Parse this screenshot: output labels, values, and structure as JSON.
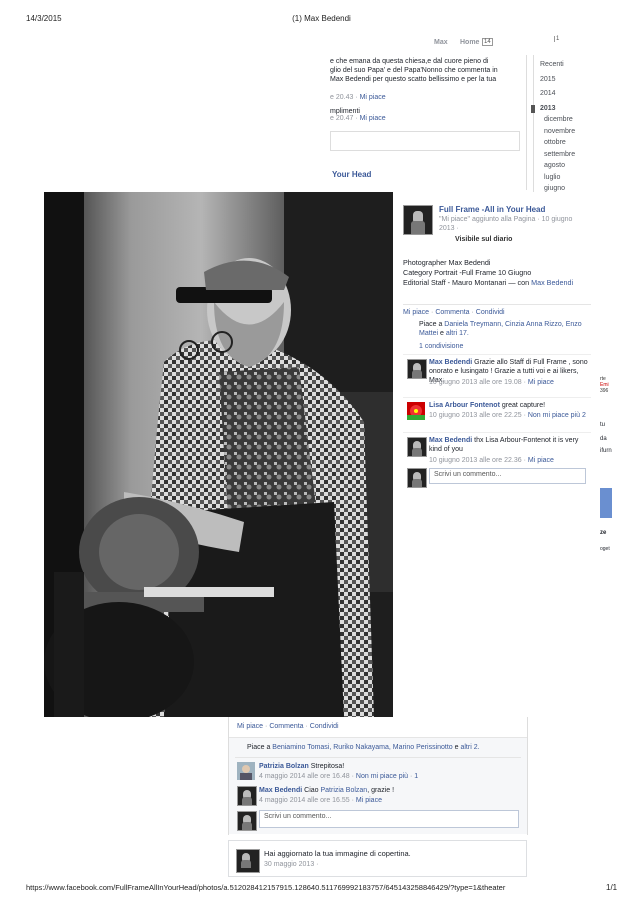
{
  "print_header": {
    "date": "14/3/2015",
    "title": "(1) Max Bedendi"
  },
  "topbar": {
    "user": "Max",
    "home": "Home",
    "home_count": "14",
    "notif": "1"
  },
  "year_sidebar": {
    "items": [
      "Recenti",
      "2015",
      "2014",
      "2013"
    ],
    "months": [
      "dicembre",
      "novembre",
      "ottobre",
      "settembre",
      "agosto",
      "luglio",
      "giugno",
      "maggio"
    ]
  },
  "bg_post": {
    "lines": [
      "e che emana da questa chiesa,e dal cuore pieno di",
      "glio del suo Papa' e del Papa'Nonno che commenta in",
      " Max Bedendi per questo scatto bellissimo e per la tua"
    ],
    "time1": "e 20.43",
    "like1": "Mi piace",
    "line2": "mplimenti",
    "time2": "e 20.47",
    "like2": "Mi piace",
    "your_head": "Your Head"
  },
  "theater": {
    "page_name": "Full Frame -All in Your Head",
    "subtitle": "\"Mi piace\" aggiunto alla Pagina · 10 giugno 2013 ·",
    "visibility": "Visibile sul diario",
    "caption1": "Photographer Max Bedendi",
    "caption2": "Category Portrait -Full Frame 10 Giugno",
    "caption3": "Editorial Staff - Mauro Montanari — con ",
    "caption3_link": "Max Bedendi",
    "actions": {
      "like": "Mi piace",
      "comment": "Commenta",
      "share": "Condividi"
    },
    "likes_prefix": "Piace a ",
    "likes_names": "Daniela Treymann, Cinzia Anna Rizzo, Enzo Mattei",
    "likes_and": " e ",
    "likes_more": "altri 17.",
    "shares": "1 condivisione",
    "comments": [
      {
        "author": "Max Bedendi",
        "text": "Grazie allo Staff di Full Frame , sono onorato e lusingato ! Grazie a tutti voi e ai likers, Max.",
        "meta": "10 giugno 2013 alle ore 19.08 · ",
        "like": "Mi piace"
      },
      {
        "author": "Lisa Arbour Fontenot",
        "text": "great capture!",
        "meta": "10 giugno 2013 alle ore 22.25 · ",
        "like": "Non mi piace più",
        "count": "2"
      },
      {
        "author": "Max Bedendi",
        "text": "thx Lisa Arbour-Fontenot it is very kind of you",
        "meta": "10 giugno 2013 alle ore 22.36 · ",
        "like": "Mi piace"
      }
    ],
    "comment_placeholder": "Scrivi un commento..."
  },
  "lower_post": {
    "actions": {
      "like": "Mi piace",
      "comment": "Commenta",
      "share": "Condividi"
    },
    "likes_prefix": "Piace a ",
    "likes_names": "Beniamino Tomasi, Ruriko Nakayama, Marino Perissinotto",
    "likes_and": " e ",
    "likes_more": "altri 2.",
    "comments": [
      {
        "author": "Patrizia Bolzan",
        "text": "Strepitosa!",
        "meta": "4 maggio 2014 alle ore 16.48 · ",
        "like": "Non mi piace più",
        "count": "1"
      },
      {
        "author": "Max Bedendi",
        "text": "Ciao ",
        "mention": "Patrizia Bolzan",
        "text2": ", grazie !",
        "meta": "4 maggio 2014 alle ore 16.55 · ",
        "like": "Mi piace"
      }
    ],
    "comment_placeholder": "Scrivi un commento..."
  },
  "cover_post": {
    "text": "Hai aggiornato la tua immagine di copertina.",
    "date": "30 maggio 2013 ·"
  },
  "right_fragments": [
    "rte",
    "Emi",
    "396",
    "tu",
    "da",
    "ifurn",
    "ze",
    "oget"
  ],
  "print_footer": {
    "url": "https://www.facebook.com/FullFrameAllInYourHead/photos/a.512028412157915.128640.511769992183757/645143258846429/?type=1&theater",
    "page": "1/1"
  },
  "colors": {
    "link": "#3b5998",
    "muted": "#90949c",
    "photo_bg": "#2b2b2b"
  }
}
